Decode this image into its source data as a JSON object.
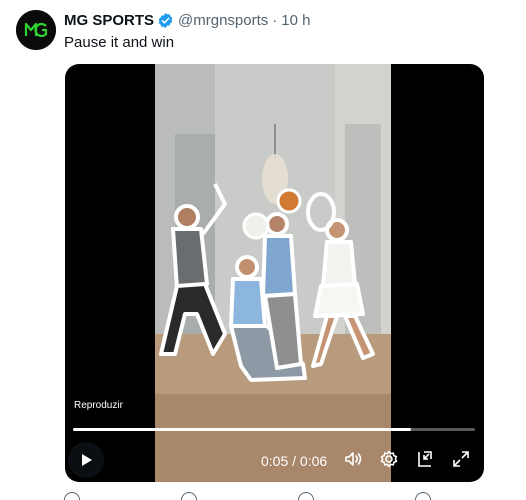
{
  "tweet": {
    "author_name": "MG SPORTS",
    "handle": "@mrgnsports",
    "separator": "·",
    "time": "10 h",
    "text": "Pause it and win",
    "verified": true,
    "avatar_icon": "mg-logo-icon",
    "verified_color": "#1d9bf0"
  },
  "video": {
    "playback_label": "Reproduzir",
    "current_time": "0:05",
    "duration": "0:06",
    "time_display": "0:05 / 0:06",
    "progress_fraction": 0.84,
    "controls": [
      "play-icon",
      "volume-icon",
      "settings-icon",
      "picture-in-picture-icon",
      "fullscreen-icon"
    ]
  },
  "actions": [
    "reply-icon",
    "retweet-icon",
    "like-icon",
    "share-icon"
  ]
}
